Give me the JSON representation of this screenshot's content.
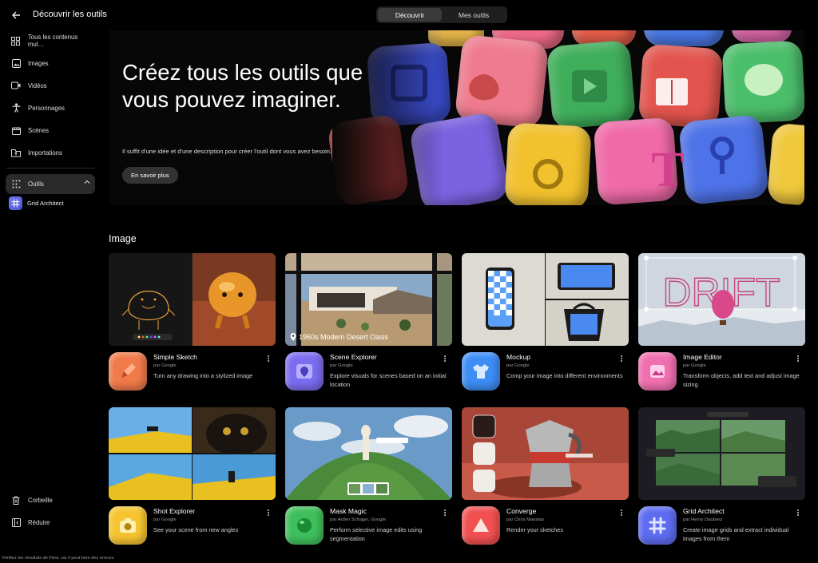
{
  "header": {
    "title": "Découvrir les outils",
    "tabs": [
      {
        "label": "Découvrir",
        "active": true
      },
      {
        "label": "Mes outils",
        "active": false
      }
    ]
  },
  "sidebar": {
    "items": [
      {
        "label": "Tous les contenus mul…",
        "icon": "grid-icon"
      },
      {
        "label": "Images",
        "icon": "image-icon"
      },
      {
        "label": "Vidéos",
        "icon": "video-icon"
      },
      {
        "label": "Personnages",
        "icon": "person-icon"
      },
      {
        "label": "Scènes",
        "icon": "scene-icon"
      },
      {
        "label": "Importations",
        "icon": "upload-icon"
      }
    ],
    "tools": {
      "label": "Outils",
      "expanded": true
    },
    "tool_items": [
      {
        "label": "Grid Architect"
      }
    ],
    "bottom": [
      {
        "label": "Corbeille",
        "icon": "trash-icon"
      },
      {
        "label": "Réduire",
        "icon": "collapse-icon"
      }
    ]
  },
  "hero": {
    "title": "Créez tous les outils que vous pouvez imaginer.",
    "subtitle": "Il suffit d'une idée et d'une description pour créer l'outil dont vous avez besoin.",
    "button": "En savoir plus"
  },
  "section": {
    "title": "Image"
  },
  "cards": [
    {
      "name": "Simple Sketch",
      "by": "par Google",
      "desc": "Turn any drawing into a stylized image",
      "caption": "",
      "icon_color": "#f07a4a"
    },
    {
      "name": "Scene Explorer",
      "by": "par Google",
      "desc": "Explore visuals for scenes based on an initial location",
      "caption": "1960s Modern Desert Oasis",
      "icon_color": "#7b6cf0"
    },
    {
      "name": "Mockup",
      "by": "par Google",
      "desc": "Comp your image into different environments",
      "caption": "",
      "icon_color": "#3d8df5"
    },
    {
      "name": "Image Editor",
      "by": "par Google",
      "desc": "Transform objects, add text and adjust image sizing",
      "caption": "",
      "icon_color": "#f06fb0"
    },
    {
      "name": "Shot Explorer",
      "by": "par Google",
      "desc": "See your scene from new angles",
      "caption": "",
      "icon_color": "#f5c430"
    },
    {
      "name": "Mask Magic",
      "by": "par Arden Schager, Google",
      "desc": "Perform selective image edits using segmentation",
      "caption": "",
      "icon_color": "#3fbf5c"
    },
    {
      "name": "Converge",
      "by": "par Chris Maestas",
      "desc": "Render your sketches",
      "caption": "",
      "icon_color": "#f05050"
    },
    {
      "name": "Grid Architect",
      "by": "par Henry Daubrez",
      "desc": "Create image grids and extract individual images from them",
      "caption": "",
      "icon_color": "#5e6cf0"
    }
  ],
  "footer": {
    "note": "Vérifiez les résultats de Flow, car il peut faire des erreurs"
  }
}
